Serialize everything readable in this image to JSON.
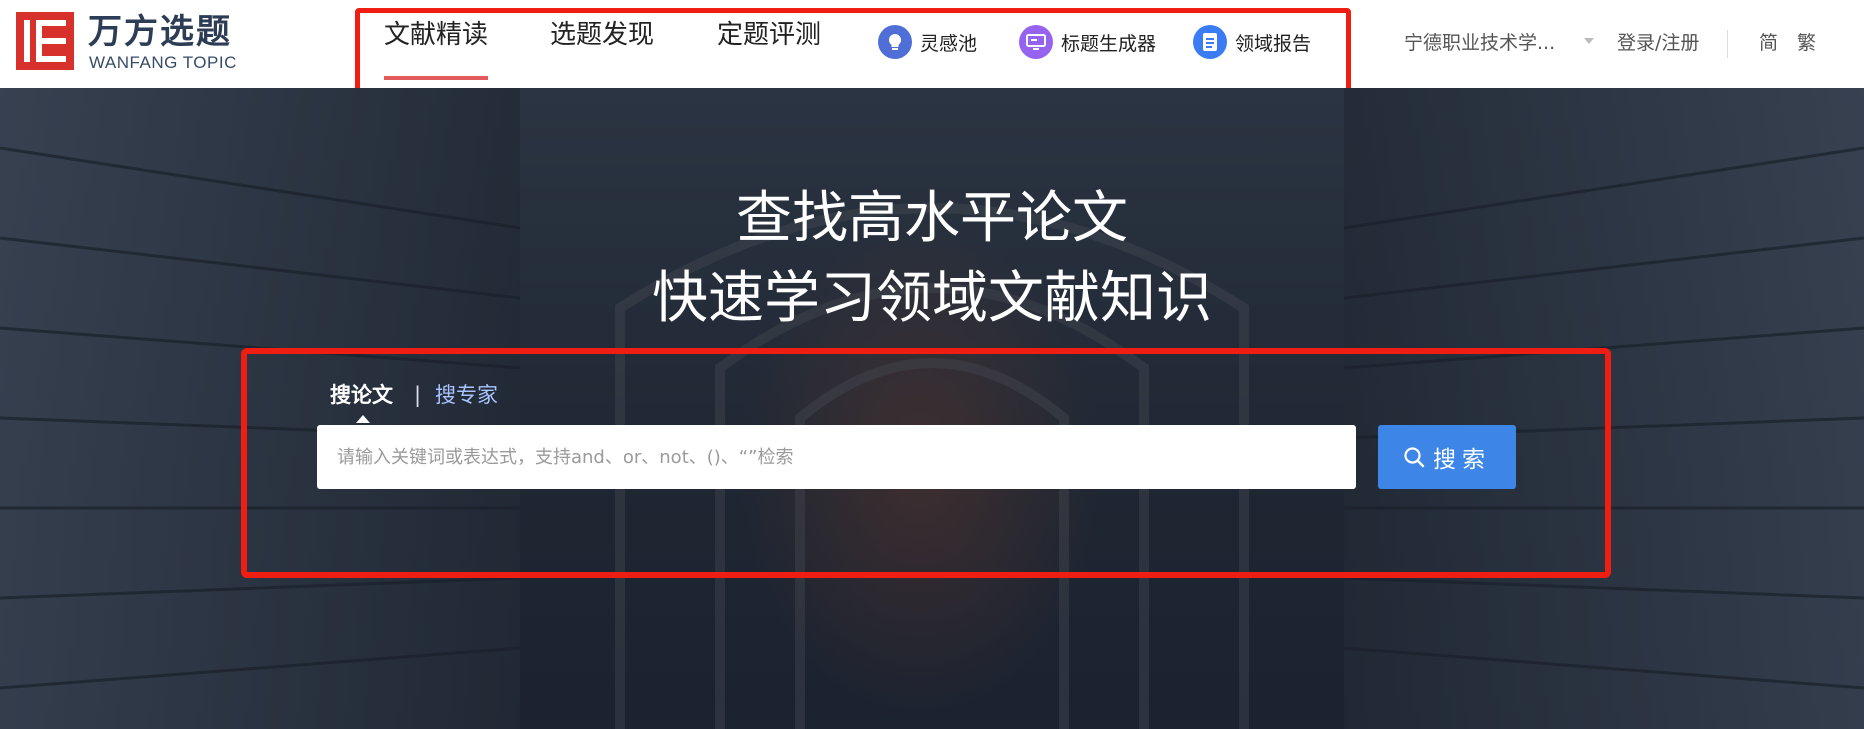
{
  "brand": {
    "name_cn": "万方选题",
    "name_en": "WANFANG TOPIC",
    "color": "#d6312b"
  },
  "nav": {
    "tabs": [
      {
        "label": "文献精读",
        "active": true
      },
      {
        "label": "选题发现",
        "active": false
      },
      {
        "label": "定题评测",
        "active": false
      }
    ],
    "features": [
      {
        "label": "灵感池",
        "icon": "lightbulb-icon"
      },
      {
        "label": "标题生成器",
        "icon": "monitor-icon"
      },
      {
        "label": "领域报告",
        "icon": "document-icon"
      }
    ]
  },
  "header_right": {
    "institution": "宁德职业技术学...",
    "login": "登录/注册",
    "lang_simplified": "简",
    "lang_traditional": "繁"
  },
  "hero": {
    "title_line1": "查找高水平论文",
    "title_line2": "快速学习领域文献知识"
  },
  "search": {
    "tab_paper": "搜论文",
    "separator": "|",
    "tab_expert": "搜专家",
    "placeholder": "请输入关键词或表达式，支持and、or、not、()、“”检索",
    "button_label": "搜索"
  },
  "colors": {
    "highlight_box": "#f01d12",
    "active_underline": "#e25a5a",
    "search_button": "#3d86e8",
    "expert_tab": "#a9c4ff"
  }
}
